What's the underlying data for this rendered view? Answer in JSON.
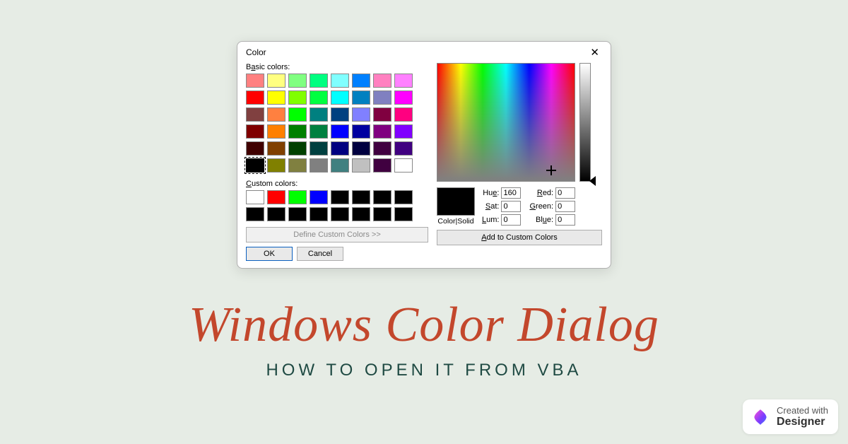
{
  "dialog": {
    "title": "Color",
    "basic_label_pre": "B",
    "basic_label_ul": "a",
    "basic_label_post": "sic colors:",
    "custom_label_pre": "",
    "custom_label_ul": "C",
    "custom_label_post": "ustom colors:",
    "define_button": "Define Custom Colors >>",
    "ok": "OK",
    "cancel": "Cancel",
    "color_solid": "Color|Solid",
    "hue_label": "Hue:",
    "sat_label": "Sat:",
    "lum_label": "Lum:",
    "red_label": "Red:",
    "green_label": "Green:",
    "blue_label": "Blue:",
    "hue": "160",
    "sat": "0",
    "lum": "0",
    "red": "0",
    "green": "0",
    "blue": "0",
    "add_button_pre": "",
    "add_button_ul": "A",
    "add_button_post": "dd to Custom Colors",
    "basic_colors": [
      "#ff8080",
      "#ffff80",
      "#80ff80",
      "#00ff80",
      "#80ffff",
      "#0080ff",
      "#ff80c0",
      "#ff80ff",
      "#ff0000",
      "#ffff00",
      "#80ff00",
      "#00ff40",
      "#00ffff",
      "#0080c0",
      "#8080c0",
      "#ff00ff",
      "#804040",
      "#ff8040",
      "#00ff00",
      "#008080",
      "#004080",
      "#8080ff",
      "#800040",
      "#ff0080",
      "#800000",
      "#ff8000",
      "#008000",
      "#008040",
      "#0000ff",
      "#0000a0",
      "#800080",
      "#8000ff",
      "#400000",
      "#804000",
      "#004000",
      "#004040",
      "#000080",
      "#000040",
      "#400040",
      "#400080",
      "#000000",
      "#808000",
      "#808040",
      "#808080",
      "#408080",
      "#c0c0c0",
      "#400040",
      "#ffffff"
    ],
    "selected_basic_index": 40,
    "custom_colors": [
      "#ffffff",
      "#ff0000",
      "#00ff00",
      "#0000ff",
      "#000000",
      "#000000",
      "#000000",
      "#000000",
      "#000000",
      "#000000",
      "#000000",
      "#000000",
      "#000000",
      "#000000",
      "#000000",
      "#000000"
    ]
  },
  "headline": "Windows Color Dialog",
  "subhead": "HOW TO OPEN IT FROM VBA",
  "badge": {
    "line1": "Created with",
    "line2": "Designer"
  }
}
